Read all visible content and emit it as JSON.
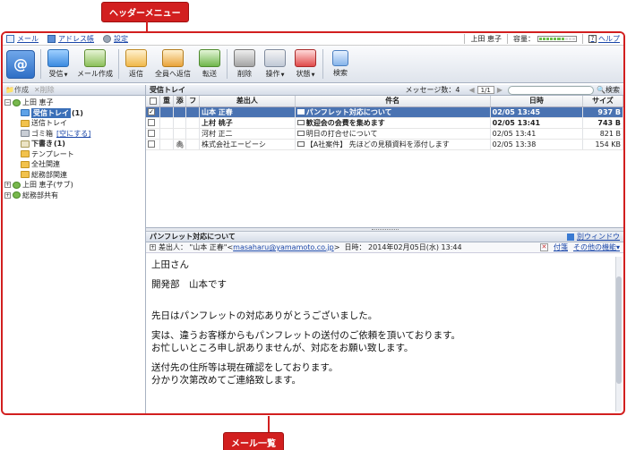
{
  "callouts": {
    "header_menu": "ヘッダーメニュー",
    "mail_list": "メール一覧"
  },
  "topbar": {
    "links": [
      {
        "label": "メール",
        "icon": "mail-icon"
      },
      {
        "label": "アドレス帳",
        "icon": "address-book-icon"
      },
      {
        "label": "設定",
        "icon": "gear-icon"
      }
    ],
    "user": "上田 恵子",
    "capacity_label": "容量：",
    "capacity_level": 0.65,
    "help": "ヘルプ"
  },
  "toolbar": {
    "buttons": [
      {
        "id": "inbox",
        "label": "受信"
      },
      {
        "id": "compose",
        "label": "メール作成"
      },
      {
        "id": "reply",
        "label": "返信"
      },
      {
        "id": "replyall",
        "label": "全員へ返信"
      },
      {
        "id": "forward",
        "label": "転送"
      },
      {
        "id": "delete",
        "label": "削除"
      },
      {
        "id": "ops",
        "label": "操作"
      },
      {
        "id": "state",
        "label": "状態"
      },
      {
        "id": "search",
        "label": "検索"
      }
    ]
  },
  "sidebar": {
    "create": "作成",
    "delete": "削除",
    "tree": {
      "root": "上田 恵子",
      "inbox": "受信トレイ",
      "inbox_count": "(1)",
      "sent": "送信トレイ",
      "trash": "ゴミ箱",
      "trash_empty": "[空にする]",
      "drafts": "下書き",
      "drafts_count": "(1)",
      "template": "テンプレート",
      "company": "全社関連",
      "general": "総務部関連",
      "sub": "上田 恵子(サブ)",
      "shared": "総務部共有"
    }
  },
  "list": {
    "title": "受信トレイ",
    "count": "メッセージ数：4",
    "page": "1/1",
    "search": "検索",
    "columns": {
      "check": "",
      "flag": "重",
      "attach": "添",
      "f": "フ",
      "from": "差出人",
      "subject": "件名",
      "date": "日時",
      "size": "サイズ"
    },
    "rows": [
      {
        "from": "山本 正春",
        "subject": "パンフレット対応について",
        "date": "02/05 13:45",
        "size": "937 B",
        "checked": "✓"
      },
      {
        "from": "上村 桃子",
        "subject": "歓迎会の会費を集めます",
        "date": "02/05 13:41",
        "size": "743 B",
        "checked": ""
      },
      {
        "from": "河村 正二",
        "subject": "明日の打合せについて",
        "date": "02/05 13:41",
        "size": "821 B",
        "checked": ""
      },
      {
        "from": "株式会社エービーシ",
        "subject": "【A社案件】 先ほどの見積資料を添付します",
        "date": "02/05 13:38",
        "size": "154 KB",
        "checked": "",
        "attach": "🖇"
      }
    ]
  },
  "preview": {
    "title": "パンフレット対応について",
    "new_window": "別ウィンドウ",
    "from_label": "差出人：",
    "from_name": "\"山本 正春\"<",
    "from_email": "masaharu@yamamoto.co.jp",
    "from_close": ">",
    "date_label": "日時：",
    "date": "2014年02月05日(水) 13:44",
    "attach": "付箋",
    "other": "その他の機能▾",
    "body": [
      "上田さん",
      "開発部　山本です",
      "",
      "先日はパンフレットの対応ありがとうございました。",
      "実は、違うお客様からもパンフレットの送付のご依頼を頂いております。",
      "お忙しいところ申し訳ありませんが、対応をお願い致します。",
      "送付先の住所等は現在確認をしております。",
      "分かり次第改めてご連絡致します。"
    ]
  }
}
